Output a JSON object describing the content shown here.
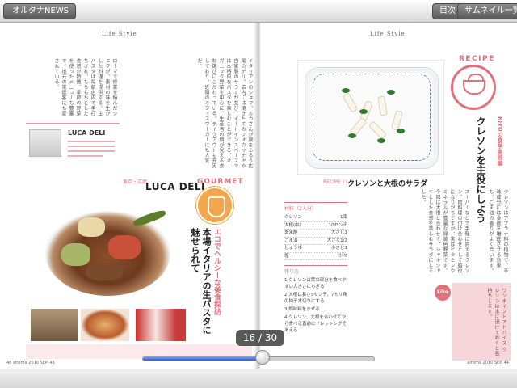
{
  "toolbar": {
    "back_label": "オルタナNEWS",
    "toc_label": "目次",
    "thumbnails_label": "サムネイル一覧"
  },
  "left_page": {
    "section": "Life Style",
    "luca_box_title": "LUCA DELI",
    "gourmet_label": "GOURMET",
    "luca_deli_title": "LUCA DELI",
    "gourmet_prefix": "東京・広尾",
    "headline_main": "本場イタリアの生パスタに魅せられて",
    "headline_sub": "エコでヘルシーな美食探訪",
    "footer": "46 alterna 2010 SEP. 46"
  },
  "right_page": {
    "section": "Life Style",
    "recipe_label": "RECIPE",
    "recipe_number": "RECIPE 11",
    "salad_title": "クレソンと大根のサラダ",
    "headline_main": "クレソンを主役にしよう",
    "headline_sub": "KIYOの食学実践編",
    "ingredients_head": "材料（2人分）",
    "ingredients": [
      {
        "name": "クレソン",
        "qty": "1束"
      },
      {
        "name": "大根(中)",
        "qty": "10センチ"
      },
      {
        "name": "玄米酢",
        "qty": "大さじ1"
      },
      {
        "name": "ごま油",
        "qty": "大さじ1/2"
      },
      {
        "name": "しょうゆ",
        "qty": "小さじ1"
      },
      {
        "name": "塩",
        "qty": "少々"
      }
    ],
    "steps_head": "作り方",
    "steps": [
      "1 クレソンは葉の部分を食べやすい大きさにちぎる",
      "2 大根は長さ5センチ、7ミリ角の拍子木切りにする",
      "3 調味料をまぜる",
      "4 クレソン、大根を合わせてから食べる直前にドレッシングであえる"
    ],
    "liko_label": "Liko",
    "footer": "alterna 2010 SEP. 44"
  },
  "pager": {
    "indicator": "16 / 30",
    "current": 16,
    "total": 30
  }
}
